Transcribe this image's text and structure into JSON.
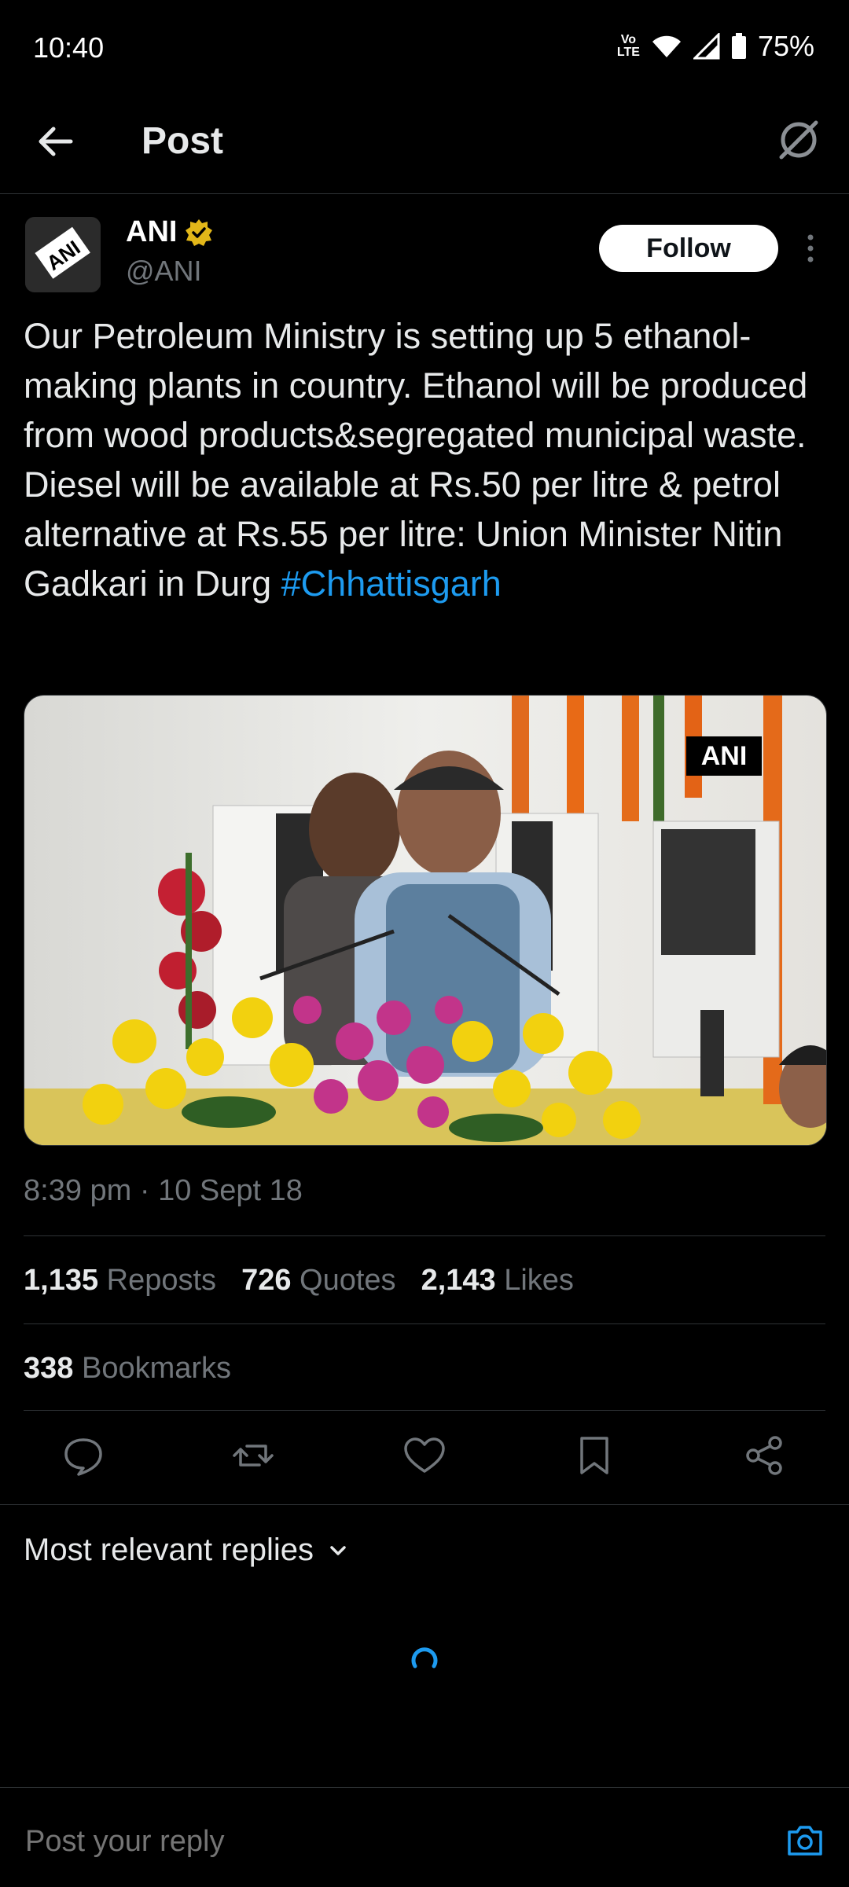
{
  "status_bar": {
    "time": "10:40",
    "battery": "75%",
    "network": "VoLTE"
  },
  "header": {
    "title": "Post"
  },
  "author": {
    "name": "ANI",
    "handle": "@ANI",
    "avatar_text": "ANI"
  },
  "follow_label": "Follow",
  "tweet": {
    "text": "Our Petroleum Ministry is setting up 5 ethanol-making plants in country. Ethanol will be produced from wood products&segregated municipal waste. Diesel will be available at Rs.50 per litre & petrol alternative at Rs.55 per litre: Union Minister Nitin Gadkari in Durg ",
    "hashtag": "#Chhattisgarh"
  },
  "media": {
    "watermark": "ANI"
  },
  "timestamp": "8:39 pm · 10 Sept 18",
  "stats": {
    "reposts_count": "1,135",
    "reposts_label": "Reposts",
    "quotes_count": "726",
    "quotes_label": "Quotes",
    "likes_count": "2,143",
    "likes_label": "Likes",
    "bookmarks_count": "338",
    "bookmarks_label": "Bookmarks"
  },
  "actions": [
    "reply-icon",
    "repost-icon",
    "like-icon",
    "bookmark-icon",
    "share-icon"
  ],
  "replies_sort": "Most relevant replies",
  "reply_box": {
    "placeholder": "Post your reply"
  },
  "colors": {
    "accent": "#1d9bf0",
    "background": "#000000",
    "muted": "#71767b",
    "verified": "#e2b719"
  }
}
